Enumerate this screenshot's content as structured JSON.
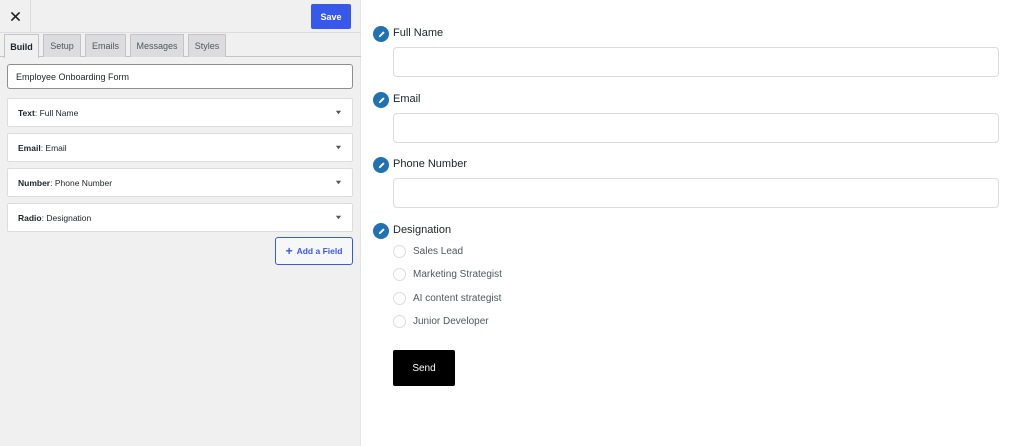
{
  "toolbar": {
    "close_icon": "close-icon",
    "save_label": "Save"
  },
  "tabs": [
    {
      "label": "Build",
      "active": true
    },
    {
      "label": "Setup",
      "active": false
    },
    {
      "label": "Emails",
      "active": false
    },
    {
      "label": "Messages",
      "active": false
    },
    {
      "label": "Styles",
      "active": false
    }
  ],
  "form": {
    "title_value": "Employee Onboarding Form"
  },
  "fields": [
    {
      "type": "Text",
      "name": "Full Name"
    },
    {
      "type": "Email",
      "name": "Email"
    },
    {
      "type": "Number",
      "name": "Phone Number"
    },
    {
      "type": "Radio",
      "name": "Designation"
    }
  ],
  "add_field_label": "Add a Field",
  "preview": {
    "full_name_label": "Full Name",
    "email_label": "Email",
    "phone_label": "Phone Number",
    "designation_label": "Designation",
    "options": [
      "Sales Lead",
      "Marketing Strategist",
      "AI content strategist",
      "Junior Developer"
    ],
    "send_label": "Send"
  },
  "colors": {
    "accent": "#3858e9",
    "edit_icon": "#2271b1",
    "send_button": "#000000",
    "panel_bg": "#f0f0f1"
  }
}
